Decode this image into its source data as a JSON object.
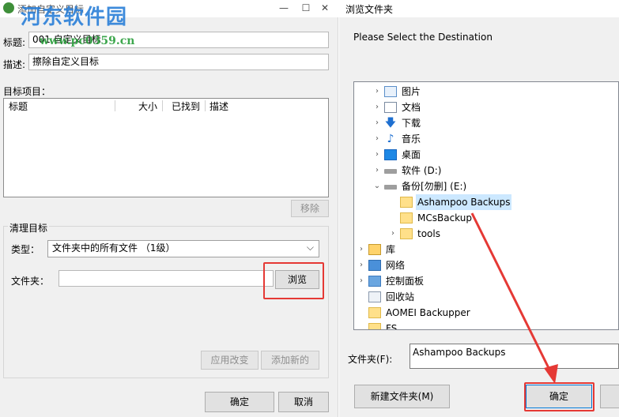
{
  "left_dialog": {
    "window_title": "添加自定义目标",
    "title_label": "标题:",
    "title_value": "001 自定义目标",
    "desc_label": "描述:",
    "desc_value": "擦除自定义目标",
    "targets_label": "目标项目：",
    "columns": [
      "标题",
      "大小",
      "已找到",
      "描述"
    ],
    "remove_button": "移除",
    "clean_group_title": "清理目标",
    "type_label": "类型：",
    "type_value": "文件夹中的所有文件 （1级）",
    "folder_label": "文件夹：",
    "folder_value": "",
    "browse_button": "浏览",
    "apply_button": "应用改变",
    "add_new_button": "添加新的",
    "ok_button": "确定",
    "cancel_button": "取消"
  },
  "watermark": {
    "text": "河东软件园",
    "url": "www.pc0359.cn"
  },
  "browse_dialog": {
    "window_title": "浏览文件夹",
    "instruction": "Please Select the Destination",
    "tree": [
      {
        "label": "图片",
        "icon": "pictures-icon",
        "expand": "collapsed"
      },
      {
        "label": "文档",
        "icon": "documents-icon",
        "expand": "collapsed"
      },
      {
        "label": "下载",
        "icon": "download-icon",
        "expand": "collapsed"
      },
      {
        "label": "音乐",
        "icon": "music-icon",
        "expand": "collapsed"
      },
      {
        "label": "桌面",
        "icon": "desktop-icon",
        "expand": "collapsed"
      },
      {
        "label": "软件 (D:)",
        "icon": "drive-icon",
        "expand": "collapsed"
      },
      {
        "label": "备份[勿删] (E:)",
        "icon": "drive-icon",
        "expand": "expanded"
      },
      {
        "label": "Ashampoo Backups",
        "icon": "folder-icon",
        "expand": "none",
        "selected": true
      },
      {
        "label": "MCsBackup",
        "icon": "folder-icon",
        "expand": "none"
      },
      {
        "label": "tools",
        "icon": "folder-icon",
        "expand": "collapsed"
      },
      {
        "label": "库",
        "icon": "library-icon",
        "expand": "collapsed"
      },
      {
        "label": "网络",
        "icon": "network-icon",
        "expand": "collapsed"
      },
      {
        "label": "控制面板",
        "icon": "control-panel-icon",
        "expand": "collapsed"
      },
      {
        "label": "回收站",
        "icon": "recycle-bin-icon",
        "expand": "none"
      },
      {
        "label": "AOMEI Backupper",
        "icon": "folder-icon",
        "expand": "none"
      },
      {
        "label": "FS",
        "icon": "folder-icon",
        "expand": "none"
      }
    ],
    "folder_label": "文件夹(F):",
    "folder_value": "Ashampoo Backups",
    "new_folder_button": "新建文件夹(M)",
    "ok_button": "确定"
  },
  "colors": {
    "highlight_red": "#e53935",
    "selection_blue": "#cce8ff",
    "watermark_blue": "#2a7fd8"
  }
}
